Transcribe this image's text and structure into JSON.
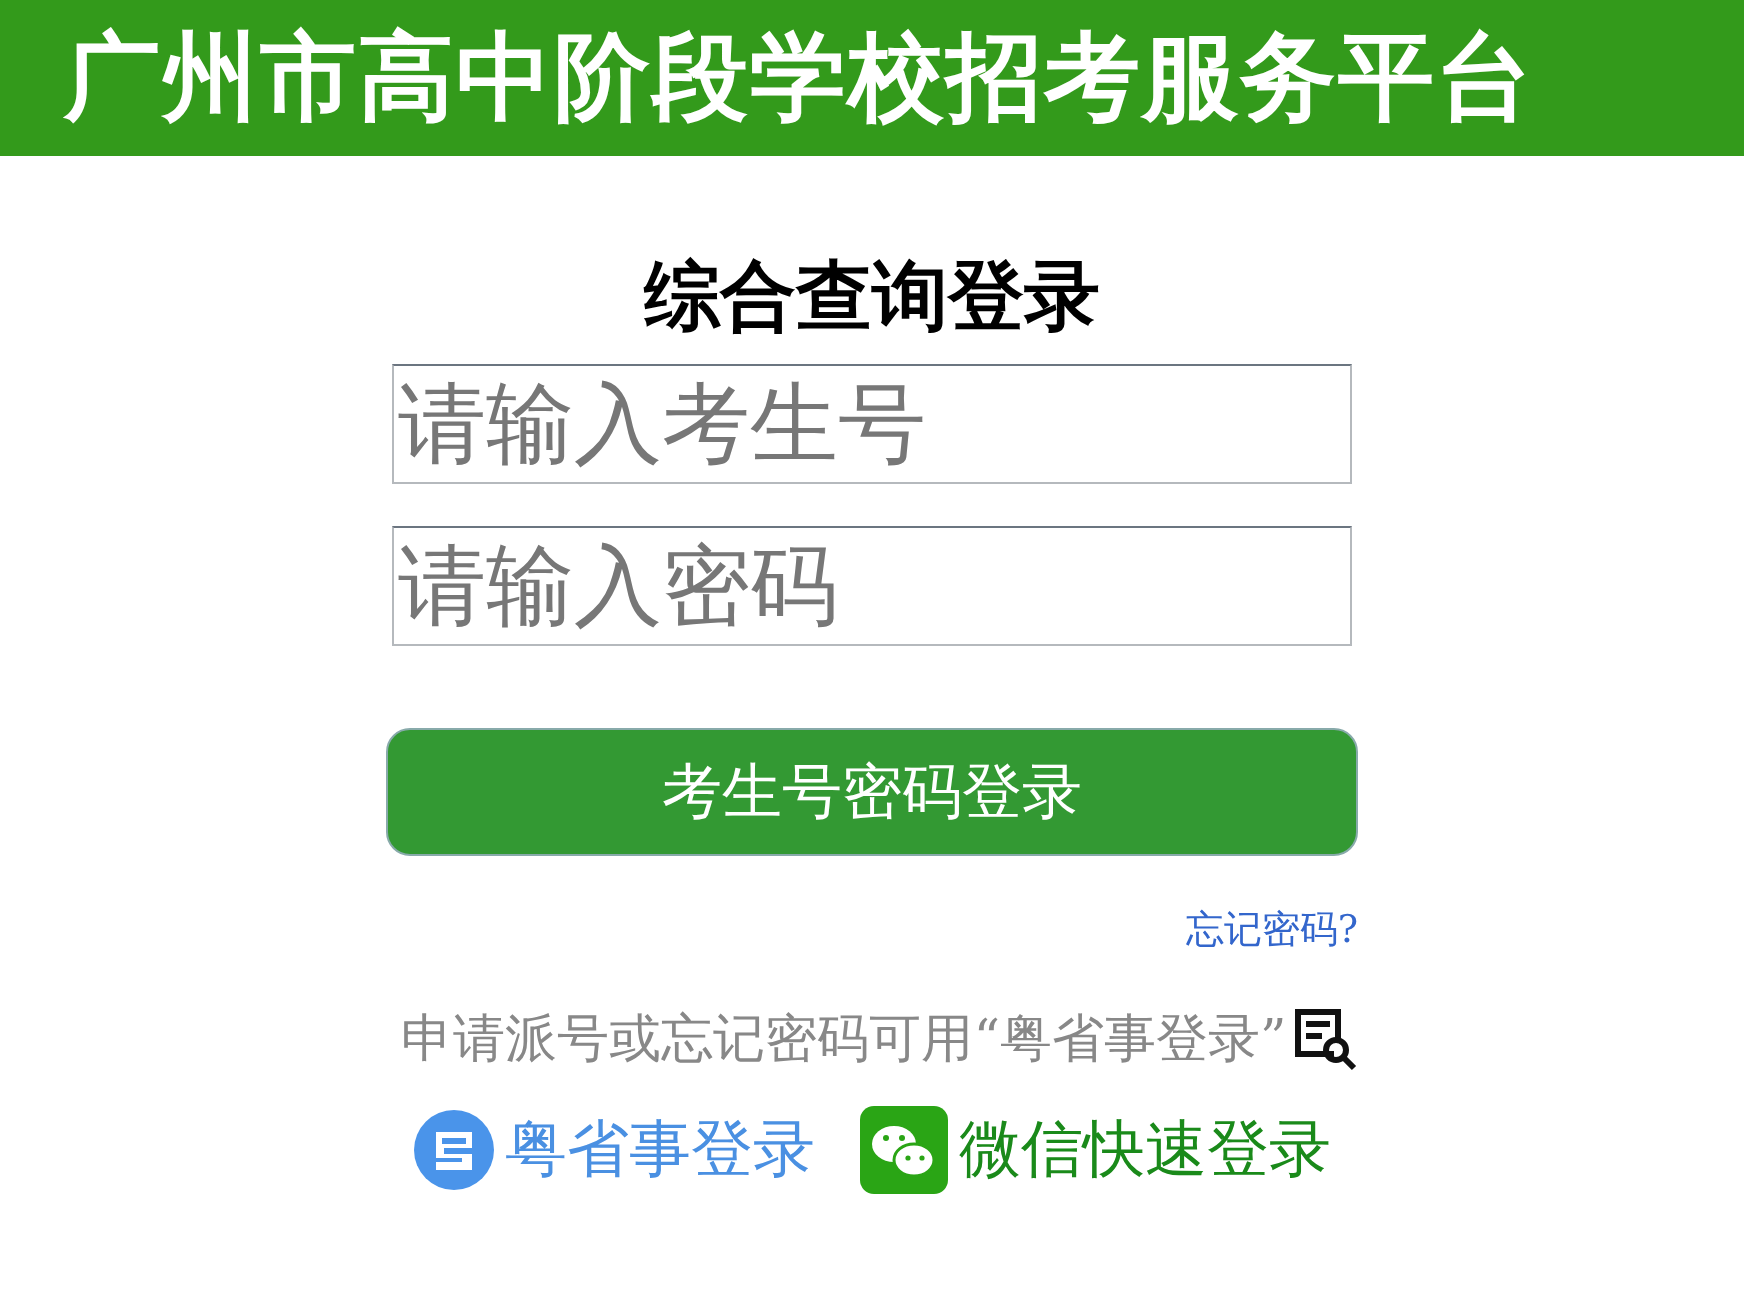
{
  "header": {
    "title": "广州市高中阶段学校招考服务平台"
  },
  "form": {
    "heading": "综合查询登录",
    "fields": [
      {
        "placeholder": "请输入考生号"
      },
      {
        "placeholder": "请输入密码"
      }
    ],
    "submit": "考生号密码登录",
    "forgot_link": "忘记密码?"
  },
  "note": "申请派号或忘记密码可用“粤省事登录”",
  "quick_logins": [
    {
      "kind": "yueshengshi",
      "label": "粤省事登录"
    },
    {
      "kind": "wechat",
      "label": "微信快速登录"
    }
  ]
}
